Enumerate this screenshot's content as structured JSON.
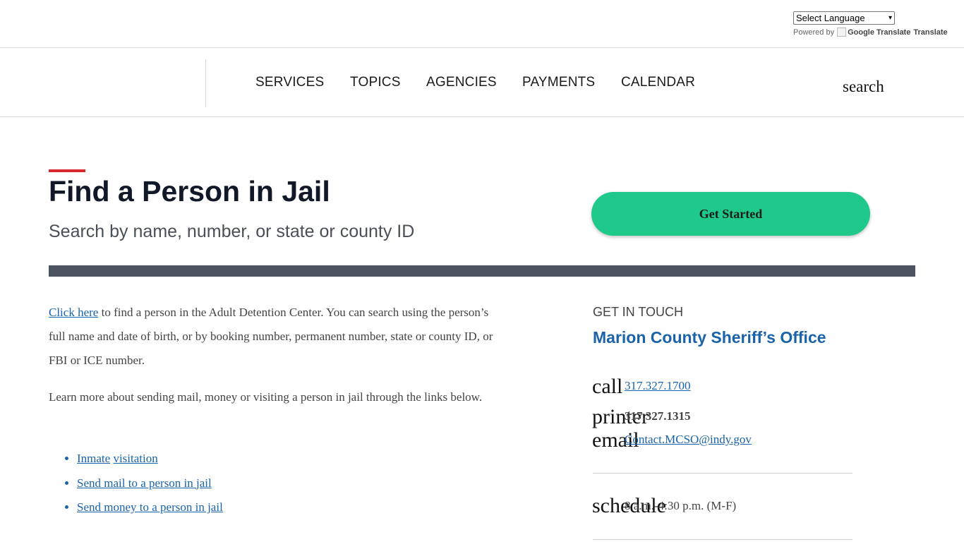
{
  "translate": {
    "select_label": "Select Language",
    "powered_by": "Powered by",
    "google_img_alt": "Google Translate",
    "translate_label": "Translate"
  },
  "nav": {
    "items": [
      "SERVICES",
      "TOPICS",
      "AGENCIES",
      "PAYMENTS",
      "CALENDAR"
    ],
    "search_label": "search"
  },
  "hero": {
    "title": "Find a Person in Jail",
    "subtitle": "Search by name, number, or state or county ID",
    "cta_label": "Get Started"
  },
  "content": {
    "p1_link": "Click here",
    "p1_text": " to find a person in the Adult Detention Center. You can search using the person’s full name and date of birth, or by booking number, permanent number, state or county ID, or FBI or ICE number.",
    "p2_text": "Learn more about sending mail, money or visiting a person in jail through the links below.",
    "links": [
      {
        "part1": "Inmate",
        "part2": "visitation"
      },
      {
        "part1": "Send mail to a person in jail"
      },
      {
        "part1": "Send money to a person in jail"
      }
    ]
  },
  "contact": {
    "heading": "GET IN TOUCH",
    "org": "Marion County Sheriff’s Office",
    "phone_icon": "call",
    "phone": "317.327.1700",
    "fax_icon": "printer",
    "fax": "317.327.1315",
    "email_icon": "email",
    "email": "Contact.MCSO@indy.gov",
    "hours_icon": "schedule",
    "hours": "8 a.m.-4:30 p.m. (M-F)"
  },
  "colors": {
    "accent_red": "#d9272e",
    "cta_green": "#1ec98a",
    "bar_slate": "#4b5260",
    "link_blue": "#1a63a8"
  }
}
